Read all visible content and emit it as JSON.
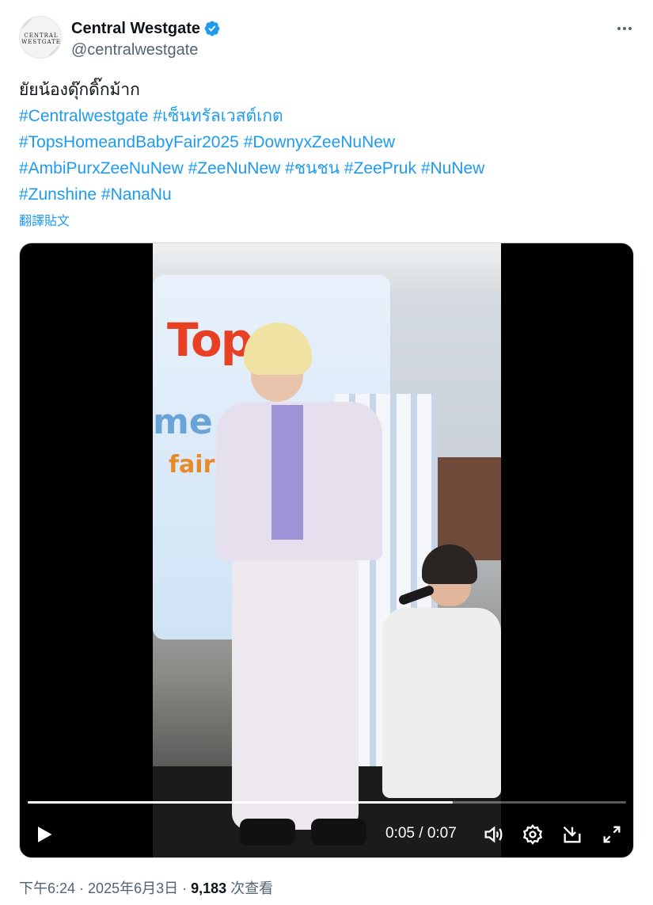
{
  "account": {
    "display_name": "Central Westgate",
    "handle": "@centralwestgate",
    "avatar_text_1": "CENTRAL",
    "avatar_text_2": "WESTGATE",
    "verified_icon": "verified-badge-icon",
    "verified_color": "#1d9bf0"
  },
  "tweet": {
    "text": "ยัยน้องดุ๊กดิ๊กม้าก",
    "hashtag_lines": [
      [
        "#Centralwestgate",
        "#เซ็นทรัลเวสต์เกต"
      ],
      [
        "#TopsHomeandBabyFair2025",
        "#DownyxZeeNuNew"
      ],
      [
        "#AmbiPurxZeeNuNew",
        "#ZeeNuNew",
        "#ชนชน",
        "#ZeePruk",
        "#NuNew"
      ],
      [
        "#Zunshine",
        "#NanaNu"
      ]
    ],
    "translate_label": "翻譯貼文",
    "link_color": "#1d9bf0"
  },
  "video": {
    "current_time": "0:05",
    "separator": " / ",
    "duration": "0:07",
    "progress": 0.71,
    "poster_text": {
      "brand_line_1": "Top",
      "brand_line_2": "me",
      "brand_line_3": "fair"
    },
    "controls": {
      "play": "play-icon",
      "volume": "volume-icon",
      "settings": "settings-icon",
      "pip": "picture-in-picture-icon",
      "fullscreen": "fullscreen-icon"
    }
  },
  "meta": {
    "time": "下午6:24",
    "date": "2025年6月3日",
    "dot": " · ",
    "views_count": "9,183",
    "views_label": "次查看"
  }
}
